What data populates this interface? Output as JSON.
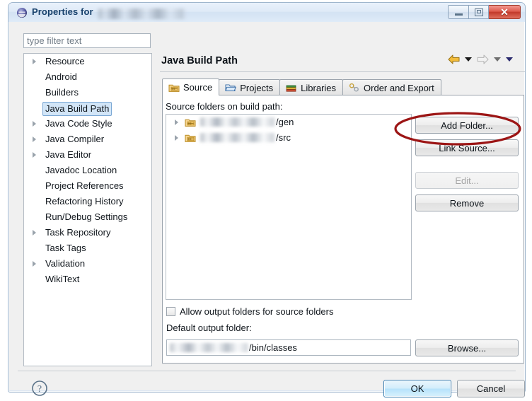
{
  "window": {
    "title_prefix": "Properties for",
    "title_project_redacted": "",
    "icon": "eclipse-icon",
    "controls": {
      "minimize": "minimize-button",
      "maximize": "restore-button",
      "close": "close-button",
      "close_glyph": "✕"
    }
  },
  "sidebar": {
    "filter": {
      "placeholder": "type filter text",
      "value": ""
    },
    "items": [
      {
        "label": "Resource",
        "expandable": true,
        "selected": false
      },
      {
        "label": "Android",
        "expandable": false,
        "selected": false
      },
      {
        "label": "Builders",
        "expandable": false,
        "selected": false
      },
      {
        "label": "Java Build Path",
        "expandable": false,
        "selected": true
      },
      {
        "label": "Java Code Style",
        "expandable": true,
        "selected": false
      },
      {
        "label": "Java Compiler",
        "expandable": true,
        "selected": false
      },
      {
        "label": "Java Editor",
        "expandable": true,
        "selected": false
      },
      {
        "label": "Javadoc Location",
        "expandable": false,
        "selected": false
      },
      {
        "label": "Project References",
        "expandable": false,
        "selected": false
      },
      {
        "label": "Refactoring History",
        "expandable": false,
        "selected": false
      },
      {
        "label": "Run/Debug Settings",
        "expandable": false,
        "selected": false
      },
      {
        "label": "Task Repository",
        "expandable": true,
        "selected": false
      },
      {
        "label": "Task Tags",
        "expandable": false,
        "selected": false
      },
      {
        "label": "Validation",
        "expandable": true,
        "selected": false
      },
      {
        "label": "WikiText",
        "expandable": false,
        "selected": false
      }
    ]
  },
  "page": {
    "title": "Java Build Path",
    "nav": {
      "back_icon": "back-arrow-icon",
      "back_dropdown_icon": "chevron-down-icon",
      "forward_icon": "forward-arrow-icon",
      "forward_dropdown_icon": "chevron-down-icon",
      "menu_icon": "chevron-down-icon"
    }
  },
  "tabs": [
    {
      "label": "Source",
      "icon": "source-folder-icon",
      "active": true
    },
    {
      "label": "Projects",
      "icon": "open-folder-icon",
      "active": false
    },
    {
      "label": "Libraries",
      "icon": "books-icon",
      "active": false
    },
    {
      "label": "Order and Export",
      "icon": "order-export-icon",
      "active": false
    }
  ],
  "source_tab": {
    "list_label": "Source folders on build path:",
    "rows": [
      {
        "redacted_prefix": "",
        "suffix": "/gen"
      },
      {
        "redacted_prefix": "",
        "suffix": "/src"
      }
    ],
    "buttons": [
      {
        "label": "Add Folder...",
        "enabled": true
      },
      {
        "label": "Link Source...",
        "enabled": true,
        "highlighted": true
      },
      {
        "label": "Edit...",
        "enabled": false
      },
      {
        "label": "Remove",
        "enabled": true
      }
    ],
    "allow_output_checkbox": {
      "label": "Allow output folders for source folders",
      "checked": false
    },
    "default_output": {
      "label": "Default output folder:",
      "value_suffix": "/bin/classes",
      "browse_label": "Browse..."
    }
  },
  "footer": {
    "help_icon": "help-question-icon",
    "ok_label": "OK",
    "cancel_label": "Cancel"
  },
  "annotation": {
    "shape": "red-ellipse",
    "target": "Link Source...",
    "color": "#9c1515"
  }
}
